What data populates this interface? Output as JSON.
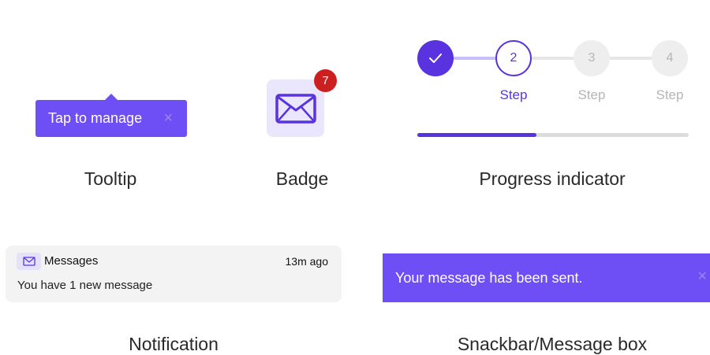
{
  "tooltip": {
    "text": "Tap to manage",
    "close_glyph": "×",
    "caption": "Tooltip"
  },
  "badge": {
    "count": "7",
    "icon": "mail-icon",
    "caption": "Badge"
  },
  "progress": {
    "steps": [
      {
        "state": "complete",
        "number": "",
        "label": ""
      },
      {
        "state": "active",
        "number": "2",
        "label": "Step"
      },
      {
        "state": "inactive",
        "number": "3",
        "label": "Step"
      },
      {
        "state": "inactive",
        "number": "4",
        "label": "Step"
      }
    ],
    "bar_fraction": 0.44,
    "caption": "Progress indicator"
  },
  "notification": {
    "icon": "mail-icon",
    "title": "Messages",
    "time": "13m ago",
    "body": "You have 1 new message",
    "caption": "Notification"
  },
  "snackbar": {
    "text": "Your message has been sent.",
    "close_glyph": "×",
    "caption": "Snackbar/Message box"
  },
  "colors": {
    "accent": "#6e4ff6",
    "accent_dark": "#5a33e0",
    "badge_red": "#cc1f1f",
    "inactive": "#eeeeee",
    "track": "#dcdcdc"
  }
}
